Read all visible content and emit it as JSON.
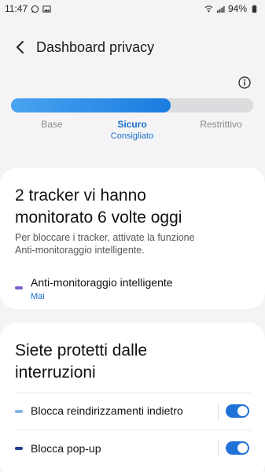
{
  "status_bar": {
    "time": "11:47",
    "battery": "94%",
    "icons": [
      "whatsapp-icon",
      "image-icon",
      "wifi-icon",
      "signal-icon",
      "battery-icon"
    ]
  },
  "header": {
    "title": "Dashboard privacy"
  },
  "protection_level": {
    "levels": [
      "Base",
      "Sicuro",
      "Restrittivo"
    ],
    "selected": "Sicuro",
    "selected_sublabel": "Consigliato",
    "fill_fraction": 0.66
  },
  "tracker_card": {
    "title_line1": "2 tracker vi hanno",
    "title_line2": "monitorato 6 volte oggi",
    "description_line1": "Per bloccare i tracker, attivate la funzione",
    "description_line2": "Anti-monitoraggio intelligente.",
    "item_label": "Anti-monitoraggio intelligente",
    "item_status": "Mai",
    "item_color": "#7b5fc6"
  },
  "interruptions_card": {
    "title_line1": "Siete protetti dalle",
    "title_line2": "interruzioni",
    "items": [
      {
        "label": "Blocca reindirizzamenti indietro",
        "color": "#8ab4e8",
        "enabled": true
      },
      {
        "label": "Blocca pop-up",
        "color": "#1f3f8c",
        "enabled": true
      }
    ]
  },
  "colors": {
    "accent": "#1f72d6",
    "link": "#1a6fc9",
    "background": "#f4f4f6"
  }
}
